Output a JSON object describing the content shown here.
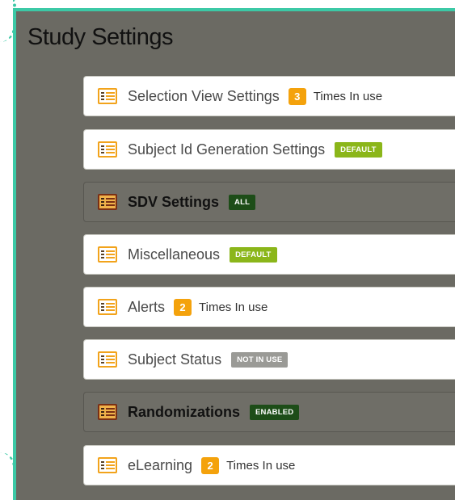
{
  "page": {
    "title": "Study Settings"
  },
  "settings": [
    {
      "label": "Selection View Settings",
      "count": "3",
      "suffix": "Times In use"
    },
    {
      "label": "Subject Id Generation Settings",
      "badge": "DEFAULT"
    },
    {
      "label": "SDV Settings",
      "badge": "ALL"
    },
    {
      "label": "Miscellaneous",
      "badge": "DEFAULT"
    },
    {
      "label": "Alerts",
      "count": "2",
      "suffix": "Times In use"
    },
    {
      "label": "Subject Status",
      "badge": "NOT IN USE"
    },
    {
      "label": "Randomizations",
      "badge": "ENABLED"
    },
    {
      "label": "eLearning",
      "count": "2",
      "suffix": "Times In use"
    }
  ],
  "colors": {
    "accent_border": "#3cc9a6",
    "panel_bg": "#6b6a63",
    "count_badge": "#f4a20c",
    "default_badge": "#8bb61a",
    "dark_badge": "#1d4d18",
    "inactive_badge": "#9a9a96"
  },
  "icons": {
    "settings_row": "list-panel-icon"
  }
}
